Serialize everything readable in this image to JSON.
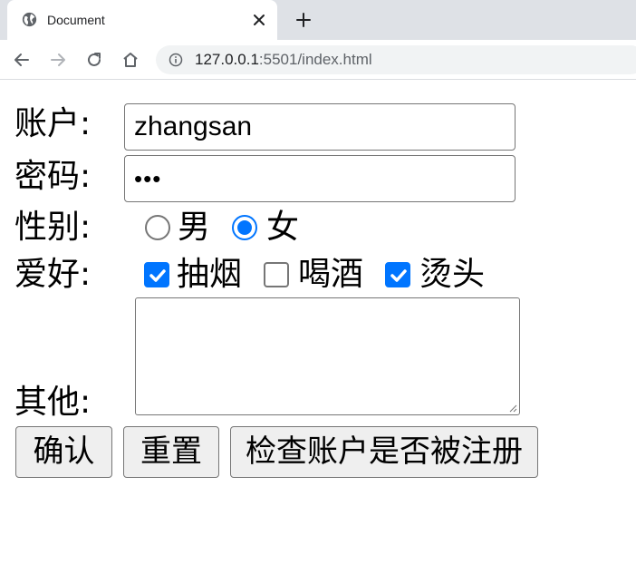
{
  "browser": {
    "tab_title": "Document",
    "url_host": "127.0.0.1",
    "url_rest": ":5501/index.html",
    "icons": [
      "globe-icon",
      "close-icon",
      "plus-icon",
      "back-icon",
      "forward-icon",
      "reload-icon",
      "home-icon",
      "info-icon"
    ]
  },
  "form": {
    "account": {
      "label": "账户:",
      "value": "zhangsan"
    },
    "password": {
      "label": "密码:",
      "masked_value": "•••"
    },
    "gender": {
      "label": "性别:",
      "options": [
        {
          "text": "男",
          "checked": false
        },
        {
          "text": "女",
          "checked": true
        }
      ]
    },
    "hobbies": {
      "label": "爱好:",
      "options": [
        {
          "text": "抽烟",
          "checked": true
        },
        {
          "text": "喝酒",
          "checked": false
        },
        {
          "text": "烫头",
          "checked": true
        }
      ]
    },
    "other": {
      "label": "其他:",
      "value": ""
    },
    "buttons": {
      "confirm": "确认",
      "reset": "重置",
      "check_account": "检查账户是否被注册"
    }
  },
  "colors": {
    "accent": "#0075ff",
    "border": "#767676",
    "button_bg": "#efefef",
    "tabstrip": "#dee1e6"
  }
}
